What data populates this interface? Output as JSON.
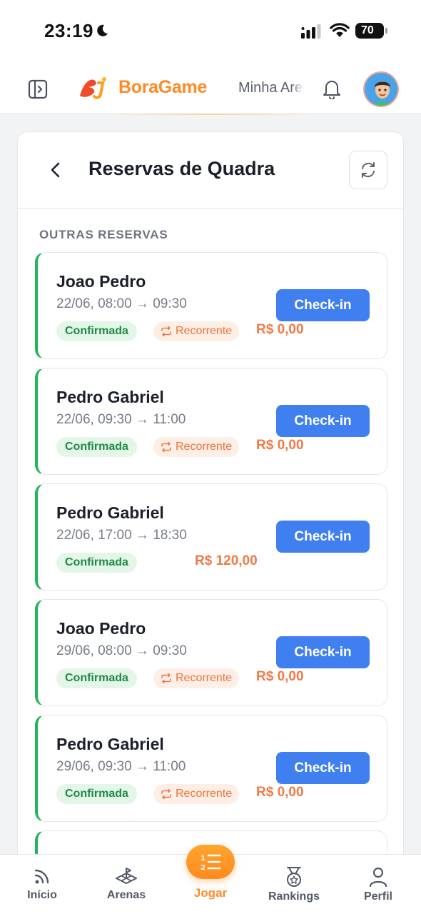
{
  "status_bar": {
    "time": "23:19",
    "battery": "70"
  },
  "header": {
    "brand": "BoraGame",
    "arena_link": "Minha Arena"
  },
  "page": {
    "title": "Reservas de Quadra",
    "section_label": "OUTRAS RESERVAS"
  },
  "reservations": [
    {
      "name": "Joao Pedro",
      "time": "22/06, 08:00 → 09:30",
      "status": "Confirmada",
      "recurring": "Recorrente",
      "price": "R$ 0,00",
      "action": "Check-in"
    },
    {
      "name": "Pedro Gabriel",
      "time": "22/06, 09:30 → 11:00",
      "status": "Confirmada",
      "recurring": "Recorrente",
      "price": "R$ 0,00",
      "action": "Check-in"
    },
    {
      "name": "Pedro Gabriel",
      "time": "22/06, 17:00 → 18:30",
      "status": "Confirmada",
      "price": "R$ 120,00",
      "action": "Check-in"
    },
    {
      "name": "Joao Pedro",
      "time": "29/06, 08:00 → 09:30",
      "status": "Confirmada",
      "recurring": "Recorrente",
      "price": "R$ 0,00",
      "action": "Check-in"
    },
    {
      "name": "Pedro Gabriel",
      "time": "29/06, 09:30 → 11:00",
      "status": "Confirmada",
      "recurring": "Recorrente",
      "price": "R$ 0,00",
      "action": "Check-in"
    }
  ],
  "nav": [
    {
      "label": "Início",
      "icon": "feed-icon"
    },
    {
      "label": "Arenas",
      "icon": "court-icon"
    },
    {
      "label": "Jogar",
      "icon": "list-numbered-icon",
      "active": true
    },
    {
      "label": "Rankings",
      "icon": "medal-icon"
    },
    {
      "label": "Perfil",
      "icon": "user-icon"
    }
  ],
  "colors": {
    "accent": "#ff8a26",
    "primary_button": "#3f7ff0",
    "confirmed": "#22b55a",
    "price": "#f07a45"
  }
}
